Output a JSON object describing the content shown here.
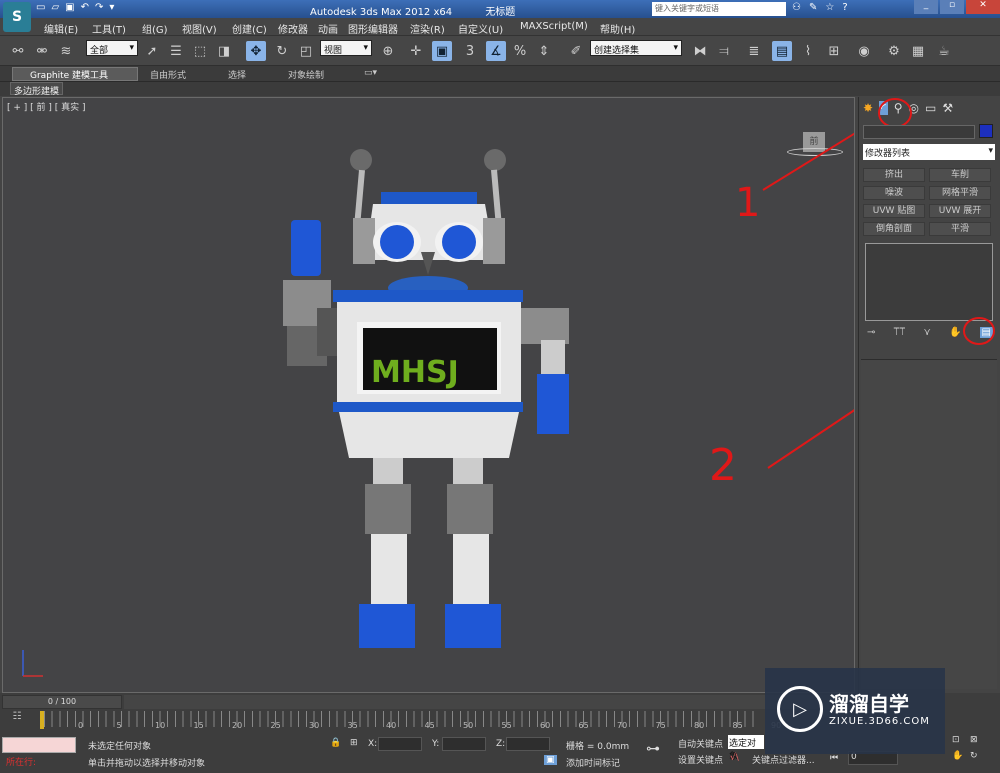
{
  "app": {
    "title_app": "Autodesk 3ds Max  2012 x64",
    "title_doc": "无标题",
    "search_placeholder": "键入关键字或短语"
  },
  "menu": [
    "编辑(E)",
    "工具(T)",
    "组(G)",
    "视图(V)",
    "创建(C)",
    "修改器",
    "动画",
    "图形编辑器",
    "渲染(R)",
    "自定义(U)",
    "MAXScript(M)",
    "帮助(H)"
  ],
  "toolbar": {
    "selection_filter": "全部",
    "ref_coord": "视图",
    "named_selection": "创建选择集"
  },
  "ribbon": {
    "tabs": [
      "Graphite 建模工具",
      "自由形式",
      "选择",
      "对象绘制"
    ],
    "sub_tab": "多边形建模"
  },
  "viewport": {
    "label": "[ + ] [ 前 ] [ 真实 ]",
    "viewcube_label": "前",
    "screen_text": "MHSJ",
    "annotations": [
      "1",
      "2"
    ]
  },
  "cmdpanel": {
    "modifier_list": "修改器列表",
    "buttons": [
      "挤出",
      "车削",
      "噪波",
      "网格平滑",
      "UVW 贴图",
      "UVW 展开",
      "倒角剖面",
      "平滑"
    ]
  },
  "timeline": {
    "frame_counter": "0 / 100",
    "ticks": [
      "0",
      "5",
      "10",
      "15",
      "20",
      "25",
      "30",
      "35",
      "40",
      "45",
      "50",
      "55",
      "60",
      "65",
      "70",
      "75",
      "80",
      "85",
      "90"
    ]
  },
  "status": {
    "current_action": "所在行:",
    "selection_status": "未选定任何对象",
    "prompt": "单击并拖动以选择并移动对象",
    "x_label": "X:",
    "y_label": "Y:",
    "z_label": "Z:",
    "grid": "栅格 = 0.0mm",
    "add_time_tag": "添加时间标记",
    "auto_key": "自动关键点",
    "set_key": "设置关键点",
    "selected_dropdown": "选定对象",
    "key_filters": "关键点过滤器...",
    "frame_value": "0"
  },
  "watermark": {
    "title": "溜溜自学",
    "url": "ZIXUE.3D66.COM"
  }
}
